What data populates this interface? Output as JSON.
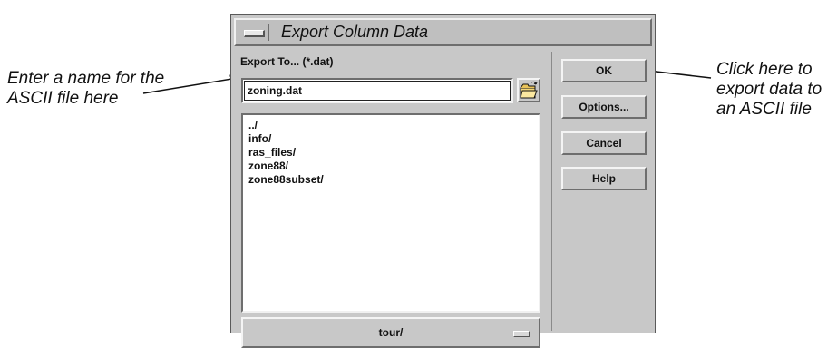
{
  "annotations": {
    "left_note": "Enter a name for the ASCII file here",
    "right_note": "Click here to export data to an ASCII file"
  },
  "dialog": {
    "title": "Export Column Data",
    "export_label": "Export To... (*.dat)",
    "filename_value": "zoning.dat",
    "file_list": [
      "../",
      "info/",
      "ras_files/",
      "zone88/",
      "zone88subset/"
    ],
    "directory": "tour/",
    "buttons": {
      "ok": "OK",
      "options": "Options...",
      "cancel": "Cancel",
      "help": "Help"
    }
  },
  "icons": {
    "window_menu": "window-menu-icon",
    "folder": "folder-open-icon",
    "directory_indicator": "option-menu-indicator-icon"
  }
}
